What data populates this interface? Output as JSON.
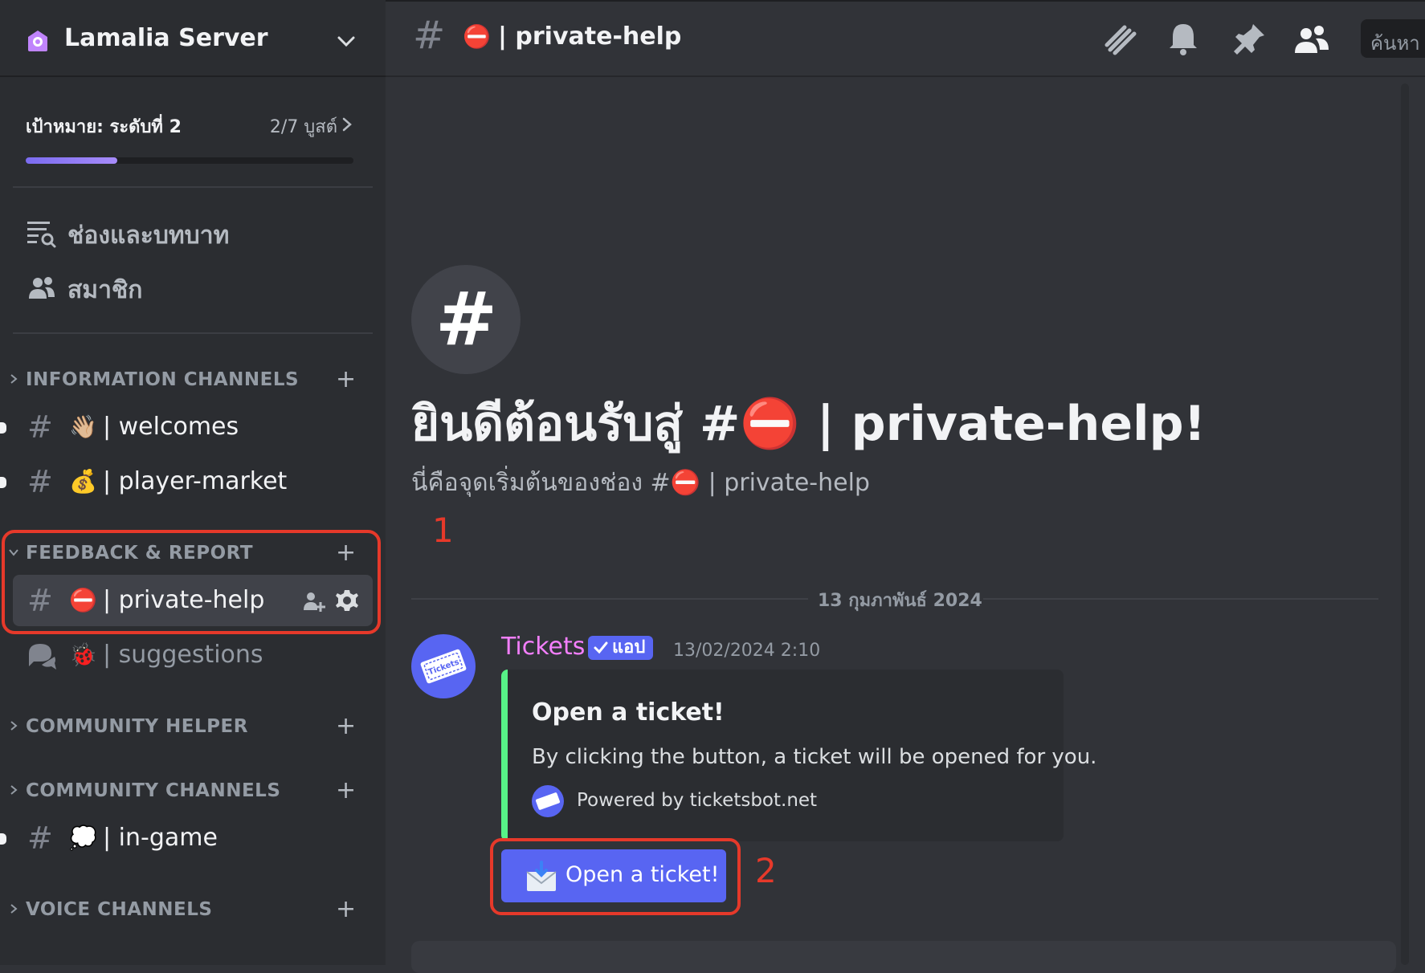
{
  "server": {
    "name": "Lamalia Server"
  },
  "boost": {
    "goal": "เป้าหมาย: ระดับที่ 2",
    "count": "2/7 บูสต์",
    "progress_fraction": 0.28
  },
  "nav": {
    "channels_roles": "ช่องและบทบาท",
    "members": "สมาชิก"
  },
  "categories": {
    "information": "INFORMATION CHANNELS",
    "feedback": "FEEDBACK & REPORT",
    "helper": "COMMUNITY HELPER",
    "community": "COMMUNITY CHANNELS",
    "voice": "VOICE CHANNELS"
  },
  "channels": {
    "welcomes": {
      "emoji": "👋🏼",
      "label": "| welcomes"
    },
    "player_market": {
      "emoji": "💰",
      "label": "| player-market"
    },
    "private_help": {
      "emoji": "⛔",
      "label": "| private-help"
    },
    "suggestions": {
      "emoji": "🐞",
      "label": "| suggestions"
    },
    "in_game": {
      "emoji": "💭",
      "label": "| in-game"
    }
  },
  "topbar": {
    "emoji": "⛔",
    "title": "| private-help",
    "search_placeholder": "ค้นหา"
  },
  "welcome": {
    "heading_prefix": "ยินดีต้อนรับสู่ #",
    "heading_emoji": "⛔",
    "heading_suffix": " | private-help!",
    "sub_prefix": "นี่คือจุดเริ่มต้นของช่อง #",
    "sub_emoji": "⛔",
    "sub_suffix": " | private-help"
  },
  "annotations": {
    "one": "1",
    "two": "2"
  },
  "date_divider": "13 กุมภาพันธ์ 2024",
  "message": {
    "author": "Tickets",
    "badge": "แอป",
    "timestamp": "13/02/2024 2:10",
    "embed": {
      "title": "Open a ticket!",
      "description": "By clicking the button, a ticket will be opened for you.",
      "footer": "Powered by ticketsbot.net"
    },
    "button_label": "Open a ticket!"
  },
  "colors": {
    "accent": "#5865f2",
    "annotation": "#e6392a",
    "embed_bar": "#57f287",
    "author": "#f47fff"
  }
}
